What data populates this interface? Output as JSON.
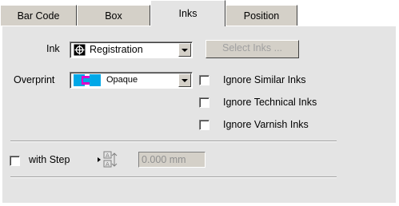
{
  "tabs": [
    {
      "label": "Bar Code",
      "active": false
    },
    {
      "label": "Box",
      "active": false
    },
    {
      "label": "Inks",
      "active": true
    },
    {
      "label": "Position",
      "active": false
    }
  ],
  "ink": {
    "label": "Ink",
    "value": "Registration",
    "icon": "registration-target-icon"
  },
  "select_inks_button": "Select Inks ...",
  "overprint": {
    "label": "Overprint",
    "value": "Opaque",
    "icon": "opaque-overprint-icon"
  },
  "checkboxes": {
    "ignore_similar": {
      "label": "Ignore Similar Inks",
      "checked": false
    },
    "ignore_technical": {
      "label": "Ignore Technical Inks",
      "checked": false
    },
    "ignore_varnish": {
      "label": "Ignore Varnish Inks",
      "checked": false
    },
    "with_step": {
      "label": "with Step",
      "checked": false
    }
  },
  "step": {
    "value": "0.000 mm",
    "icon": "step-repeat-icon"
  },
  "colors": {
    "panel": "#e4e4e4",
    "tab_inactive": "#d4d0c8",
    "disabled_text": "#a0a0a0"
  }
}
